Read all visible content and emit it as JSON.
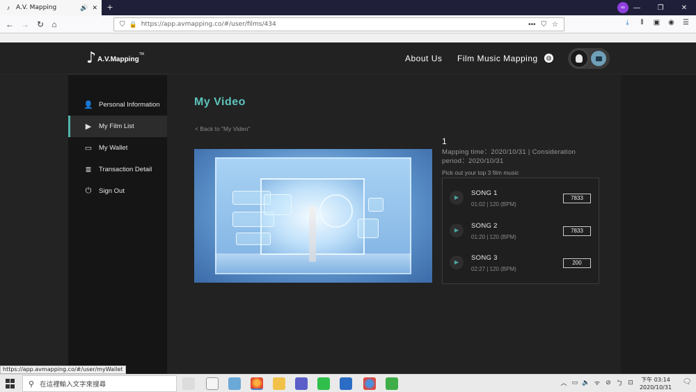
{
  "browser": {
    "tab_title": "A.V. Mapping",
    "tab_audio_icon": "speaker-icon",
    "close_icon": "close-icon",
    "new_tab": "+",
    "url": "https://app.avmapping.co/#/user/films/434",
    "status_link": "https://app.avmapping.co/#/user/myWallet"
  },
  "site": {
    "brand": {
      "mark": "♪",
      "name": "A.V.Mapping",
      "tm": "TM"
    },
    "nav": {
      "about": "About Us",
      "film_music_mapping": "Film Music Mapping"
    },
    "sidebar": {
      "items": [
        {
          "label": "Personal Information",
          "icon": "person-icon"
        },
        {
          "label": "My Film List",
          "icon": "play-box-icon"
        },
        {
          "label": "My Wallet",
          "icon": "wallet-icon"
        },
        {
          "label": "Transaction Detail",
          "icon": "list-icon"
        },
        {
          "label": "Sign Out",
          "icon": "power-icon"
        }
      ],
      "active_index": 1
    },
    "page": {
      "title": "My Video",
      "back_link": "< Back to \"My Video\"",
      "film_number": "1",
      "mapping_info": "Mapping time：2020/10/31 | Consideration period：2020/10/31",
      "pick_out": "Pick out your top 3 film music",
      "songs": [
        {
          "title": "SONG 1",
          "meta": "01:02 | 120 (BPM)",
          "votes": "7833"
        },
        {
          "title": "SONG 2",
          "meta": "01:20 | 120 (BPM)",
          "votes": "7833"
        },
        {
          "title": "SONG 3",
          "meta": "02:27 | 120 (BPM)",
          "votes": "200"
        }
      ]
    }
  },
  "taskbar": {
    "search_placeholder": "在這裡輸入文字來搜尋",
    "clock_time": "下午 03:14",
    "clock_date": "2020/10/31"
  },
  "colors": {
    "accent": "#5ec4bb",
    "site_bg": "#1e1e1e",
    "sidebar_bg": "#151515"
  }
}
